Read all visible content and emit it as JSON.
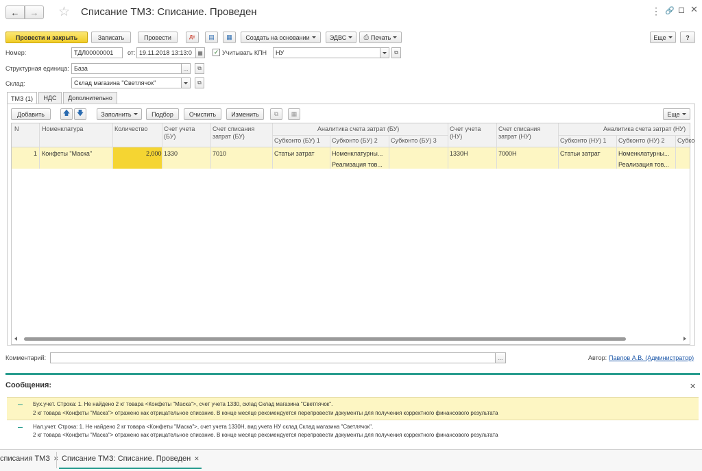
{
  "window": {
    "title": "Списание ТМЗ: Списание. Проведен"
  },
  "toolbar": {
    "post_close": "Провести и закрыть",
    "save": "Записать",
    "post": "Провести",
    "create_based": "Создать на основании",
    "edvs": "ЭДВС",
    "print": "Печать",
    "more": "Еще",
    "help": "?"
  },
  "form": {
    "number_label": "Номер:",
    "number_value": "ТДЛ00000001",
    "date_label": "от:",
    "date_value": "19.11.2018 13:13:0",
    "kpn_label": "Учитывать КПН",
    "kpn_checked": true,
    "kpn_value": "НУ",
    "unit_label": "Структурная единица:",
    "unit_value": "База",
    "warehouse_label": "Склад:",
    "warehouse_value": "Склад магазина \"Светлячок\""
  },
  "tabs": [
    "ТМЗ (1)",
    "НДС",
    "Дополнительно"
  ],
  "table_toolbar": {
    "add": "Добавить",
    "fill": "Заполнить",
    "select": "Подбор",
    "clear": "Очистить",
    "change": "Изменить",
    "more": "Еще"
  },
  "table": {
    "headers": {
      "n": "N",
      "nomenclature": "Номенклатура",
      "quantity": "Количество",
      "account_bu": "Счет учета (БУ)",
      "writeoff_bu": "Счет списания затрат (БУ)",
      "analytics_bu": "Аналитика счета затрат (БУ)",
      "sub_bu1": "Субконто (БУ) 1",
      "sub_bu2": "Субконто (БУ) 2",
      "sub_bu3": "Субконто (БУ) 3",
      "account_nu": "Счет учета (НУ)",
      "writeoff_nu": "Счет списания затрат (НУ)",
      "analytics_nu": "Аналитика счета затрат (НУ)",
      "sub_nu1": "Субконто (НУ) 1",
      "sub_nu2": "Субконто (НУ) 2",
      "sub_nu3": "Субко"
    },
    "row": {
      "n": "1",
      "nomenclature": "Конфеты \"Маска\"",
      "quantity": "2,000",
      "account_bu": "1330",
      "writeoff_bu": "7010",
      "sub_bu1": "Статьи затрат",
      "sub_bu2": "Номенклатурны...",
      "sub_bu2b": "Реализация тов...",
      "account_nu": "1330Н",
      "writeoff_nu": "7000Н",
      "sub_nu1": "Статьи затрат",
      "sub_nu2": "Номенклатурны...",
      "sub_nu2b": "Реализация тов..."
    }
  },
  "footer": {
    "comment_label": "Комментарий:",
    "comment_value": "",
    "author_label": "Автор:",
    "author_value": "Павлов А.В. (Администратор)"
  },
  "messages": {
    "title": "Сообщения:",
    "items": [
      {
        "line1": "Бух.учет. Строка: 1. Не найдено 2 кг товара <Конфеты \"Маска\">, счет учета 1330, склад Склад магазина \"Светлячок\".",
        "line2": "2 кг товара <Конфеты \"Маска\"> отражено как отрицательное списание. В конце месяце рекомендуется перепровести документы для получения корректного финансового результата"
      },
      {
        "line1": "Нал.учет. Строка: 1. Не найдено 2 кг товара <Конфеты \"Маска\">, счет учета 1330Н, вид учета НУ склад Склад магазина \"Светлячок\".",
        "line2": "2 кг товара <Конфеты \"Маска\"> отражено как отрицательное списание. В конце месяце рекомендуется перепровести документы для получения корректного финансового результата"
      }
    ]
  },
  "bottom_tabs": [
    "списания ТМЗ",
    "Списание ТМЗ: Списание. Проведен"
  ],
  "colors": {
    "accent_yellow": "#f5d532",
    "row_yellow": "#fdf6c3",
    "teal": "#2a9d8f",
    "link": "#1a56a8"
  }
}
